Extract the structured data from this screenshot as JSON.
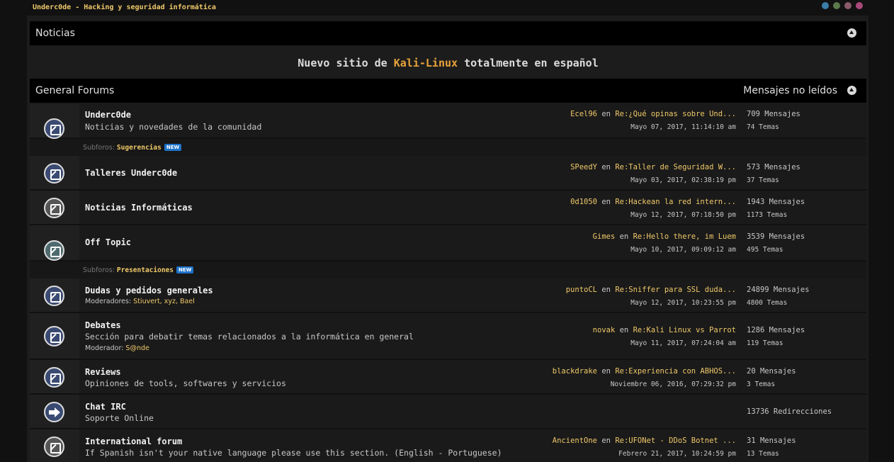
{
  "site": {
    "title": "Underc0de - Hacking y seguridad informática",
    "style_dots": [
      "#3a7ea8",
      "#5b7a4a",
      "#8a5a6a",
      "#a8487a"
    ]
  },
  "noticias": {
    "title": "Noticias",
    "headline_prefix": "Nuevo sitio de ",
    "headline_highlight": "Kali-Linux",
    "headline_suffix": " totalmente en español"
  },
  "general": {
    "title": "General Forums",
    "unread": "Mensajes no leídos"
  },
  "connector": "en",
  "boards": [
    {
      "name": "Underc0de",
      "desc": "Noticias y novedades de la comunidad",
      "last_user": "Ecel96",
      "last_topic": "Re:¿Qué opinas sobre Und...",
      "last_date": "Mayo 07, 2017, 11:14:10 am",
      "stat1": "709 Mensajes",
      "stat2": "74 Temas",
      "icon": "board-icon"
    },
    {
      "name": "Talleres Underc0de",
      "last_user": "SPeedY",
      "last_topic": "Re:Taller de Seguridad W...",
      "last_date": "Mayo 03, 2017, 02:38:19 pm",
      "stat1": "573 Mensajes",
      "stat2": "37 Temas",
      "icon": "board-icon"
    },
    {
      "name": "Noticias Informáticas",
      "last_user": "0d1050",
      "last_topic": "Re:Hackean la red intern...",
      "last_date": "Mayo 12, 2017, 07:18:50 pm",
      "stat1": "1943 Mensajes",
      "stat2": "1173 Temas",
      "icon": "board-icon"
    },
    {
      "name": "Off Topic",
      "last_user": "Gimes",
      "last_topic": "Re:Hello there, im Luem",
      "last_date": "Mayo 10, 2017, 09:09:12 am",
      "stat1": "3539 Mensajes",
      "stat2": "495 Temas",
      "icon": "board-icon"
    },
    {
      "name": "Dudas y pedidos generales",
      "mods_label": "Moderadores: ",
      "mods": "Stiuvert, xyz, Bael",
      "last_user": "puntoCL",
      "last_topic": "Re:Sniffer para SSL duda...",
      "last_date": "Mayo 12, 2017, 10:23:55 pm",
      "stat1": "24899 Mensajes",
      "stat2": "4800 Temas",
      "icon": "board-icon"
    },
    {
      "name": "Debates",
      "desc": "Sección para debatir temas relacionados a la informática en general",
      "mods_label": "Moderador: ",
      "mods": "S@nde",
      "last_user": "novak",
      "last_topic": "Re:Kali Linux vs Parrot",
      "last_date": "Mayo 11, 2017, 07:24:04 am",
      "stat1": "1286 Mensajes",
      "stat2": "119 Temas",
      "icon": "board-icon"
    },
    {
      "name": "Reviews",
      "desc": "Opiniones de tools, softwares y servicios",
      "last_user": "blackdrake",
      "last_topic": "Re:Experiencia con ABHOS...",
      "last_date": "Noviembre 06, 2016, 07:29:32 pm",
      "stat1": "20 Mensajes",
      "stat2": "3 Temas",
      "icon": "board-icon"
    },
    {
      "name": "Chat IRC",
      "desc": "Soporte Online",
      "stat1": "13736 Redirecciones",
      "icon": "redirect-icon"
    },
    {
      "name": "International forum",
      "desc": "If Spanish isn't your native language please use this section. (English - Portuguese)",
      "last_user": "AncientOne",
      "last_topic": "Re:UFONet - DDoS Botnet ...",
      "last_date": "Febrero 21, 2017, 10:24:59 pm",
      "stat1": "31 Mensajes",
      "stat2": "13 Temas",
      "icon": "board-icon"
    }
  ],
  "subforos": [
    {
      "label": "Subforos: ",
      "link": "Sugerencias",
      "badge": "NEW"
    },
    {
      "label": "Subforos: ",
      "link": "Presentaciones",
      "badge": "NEW"
    }
  ]
}
